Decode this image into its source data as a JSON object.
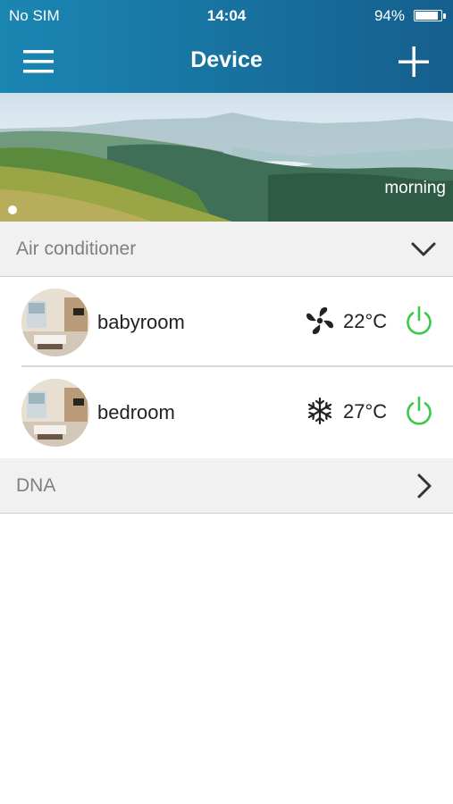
{
  "status_bar": {
    "carrier": "No SIM",
    "time": "14:04",
    "battery_text": "94%",
    "battery_level": 0.94
  },
  "nav": {
    "title": "Device",
    "menu_icon": "hamburger-menu-icon",
    "add_icon": "plus-icon"
  },
  "banner": {
    "caption": "morning",
    "page_index": 1
  },
  "sections": [
    {
      "label": "Air conditioner",
      "expanded": true,
      "icon": "chevron-down-icon",
      "devices": [
        {
          "name": "babyroom",
          "mode_icon": "fan-icon",
          "temperature": "22°C",
          "power_color": "#3ac94b"
        },
        {
          "name": "bedroom",
          "mode_icon": "snowflake-icon",
          "temperature": "27°C",
          "power_color": "#3ac94b"
        }
      ]
    },
    {
      "label": "DNA",
      "expanded": false,
      "icon": "chevron-right-icon"
    }
  ],
  "colors": {
    "header_start": "#1b86b3",
    "header_end": "#155f8d",
    "power_on": "#3ac94b",
    "section_bg": "#f1f1f1"
  }
}
